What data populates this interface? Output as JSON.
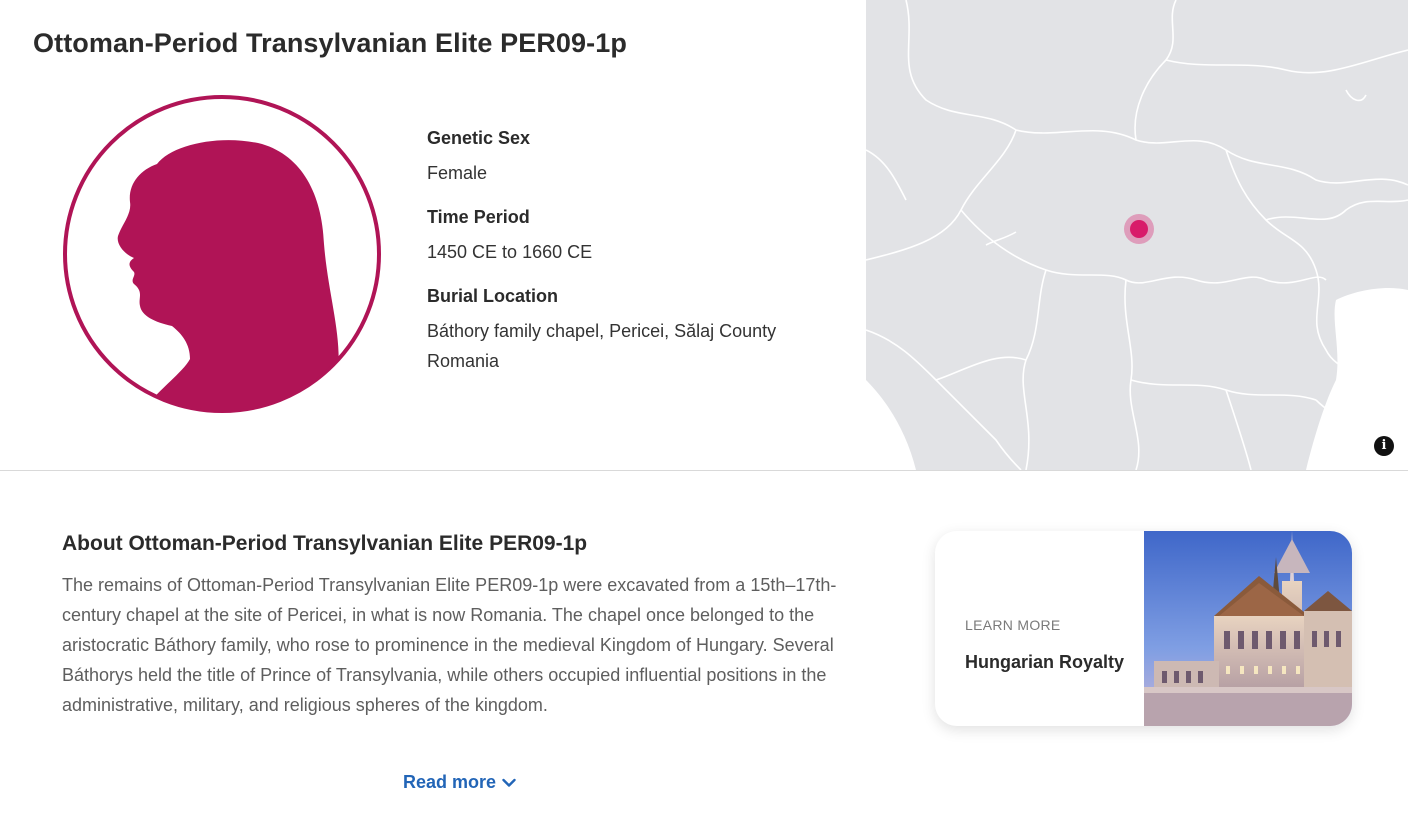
{
  "header": {
    "title": "Ottoman-Period Transylvanian Elite PER09-1p"
  },
  "facts": [
    {
      "label": "Genetic Sex",
      "value": "Female"
    },
    {
      "label": "Time Period",
      "value": "1450 CE to 1660 CE"
    },
    {
      "label": "Burial Location",
      "value": "Báthory family chapel, Pericei, Sălaj County Romania"
    }
  ],
  "colors": {
    "accent": "#b01456",
    "map_bg": "#e2e3e6",
    "map_marker": "#d81b6a",
    "link": "#2265b7"
  },
  "map": {
    "info_icon": "info-icon",
    "info_glyph": "i"
  },
  "about": {
    "title": "About Ottoman-Period Transylvanian Elite PER09-1p",
    "text": "The remains of Ottoman-Period Transylvanian Elite PER09-1p were excavated from a 15th–17th-century chapel at the site of Pericei, in what is now Romania. The chapel once belonged to the aristocratic Báthory family, who rose to prominence in the medieval Kingdom of Hungary. Several Báthorys held the title of Prince of Transylvania, while others occupied influential positions in the administrative, military, and religious spheres of the kingdom.",
    "read_more": "Read more",
    "read_more_icon": "chevron-down-icon"
  },
  "learn_more_card": {
    "kicker": "LEARN MORE",
    "title": "Hungarian Royalty",
    "image": "gothic-church-photo"
  }
}
